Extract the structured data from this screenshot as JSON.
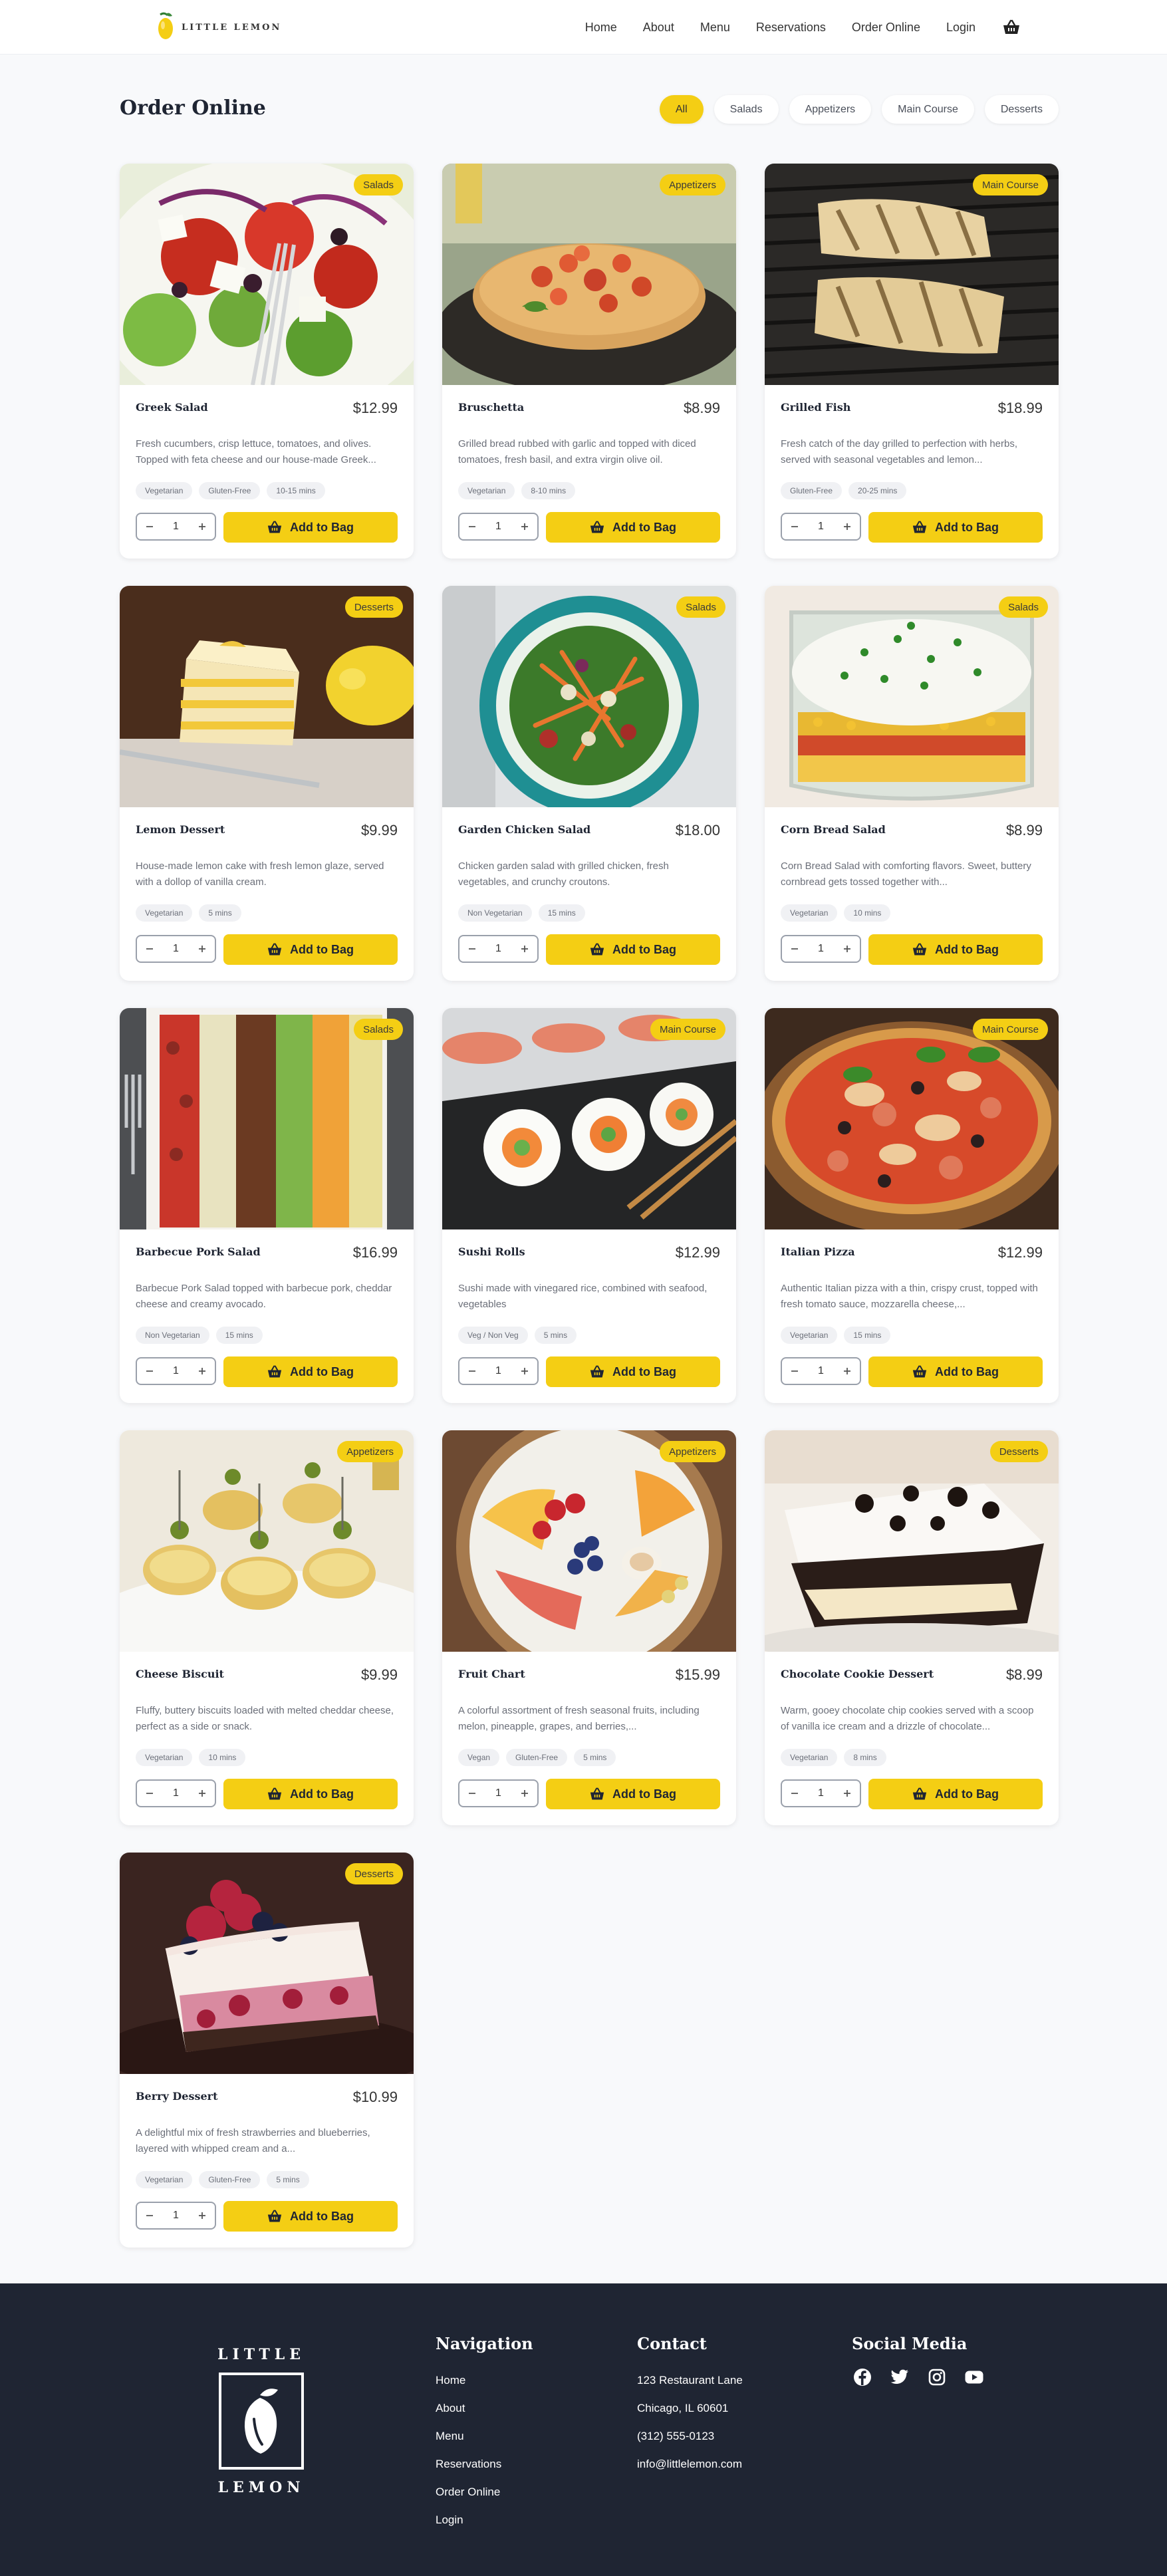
{
  "header": {
    "logo_text": "LITTLE LEMON",
    "nav": [
      "Home",
      "About",
      "Menu",
      "Reservations",
      "Order Online",
      "Login"
    ]
  },
  "page": {
    "title": "Order Online",
    "filters": [
      "All",
      "Salads",
      "Appetizers",
      "Main Course",
      "Desserts"
    ],
    "active_filter": "All"
  },
  "add_label": "Add to Bag",
  "items": [
    {
      "name": "Greek Salad",
      "price": "$12.99",
      "category": "Salads",
      "desc": "Fresh cucumbers, crisp lettuce, tomatoes, and olives. Topped with feta cheese and our house-made Greek...",
      "tags": [
        "Vegetarian",
        "Gluten-Free",
        "10-15 mins"
      ],
      "qty": "1",
      "image": "greek-salad"
    },
    {
      "name": "Bruschetta",
      "price": "$8.99",
      "category": "Appetizers",
      "desc": "Grilled bread rubbed with garlic and topped with diced tomatoes, fresh basil, and extra virgin olive oil.",
      "tags": [
        "Vegetarian",
        "8-10 mins"
      ],
      "qty": "1",
      "image": "bruschetta"
    },
    {
      "name": "Grilled Fish",
      "price": "$18.99",
      "category": "Main Course",
      "desc": "Fresh catch of the day grilled to perfection with herbs, served with seasonal vegetables and lemon...",
      "tags": [
        "Gluten-Free",
        "20-25 mins"
      ],
      "qty": "1",
      "image": "grilled-fish"
    },
    {
      "name": "Lemon Dessert",
      "price": "$9.99",
      "category": "Desserts",
      "desc": "House-made lemon cake with fresh lemon glaze, served with a dollop of vanilla cream.",
      "tags": [
        "Vegetarian",
        "5 mins"
      ],
      "qty": "1",
      "image": "lemon-dessert"
    },
    {
      "name": "Garden Chicken Salad",
      "price": "$18.00",
      "category": "Salads",
      "desc": "Chicken garden salad with grilled chicken, fresh vegetables, and crunchy croutons.",
      "tags": [
        "Non Vegetarian",
        "15 mins"
      ],
      "qty": "1",
      "image": "chicken-salad"
    },
    {
      "name": "Corn Bread Salad",
      "price": "$8.99",
      "category": "Salads",
      "desc": "Corn Bread Salad with comforting flavors. Sweet, buttery cornbread gets tossed together with...",
      "tags": [
        "Vegetarian",
        "10 mins"
      ],
      "qty": "1",
      "image": "cornbread-salad"
    },
    {
      "name": "Barbecue Pork Salad",
      "price": "$16.99",
      "category": "Salads",
      "desc": "Barbecue Pork Salad topped with barbecue pork, cheddar cheese and creamy avocado.",
      "tags": [
        "Non Vegetarian",
        "15 mins"
      ],
      "qty": "1",
      "image": "bbq-salad"
    },
    {
      "name": "Sushi Rolls",
      "price": "$12.99",
      "category": "Main Course",
      "desc": "Sushi made with vinegared rice, combined with seafood, vegetables",
      "tags": [
        "Veg / Non Veg",
        "5 mins"
      ],
      "qty": "1",
      "image": "sushi"
    },
    {
      "name": "Italian Pizza",
      "price": "$12.99",
      "category": "Main Course",
      "desc": "Authentic Italian pizza with a thin, crispy crust, topped with fresh tomato sauce, mozzarella cheese,...",
      "tags": [
        "Vegetarian",
        "15 mins"
      ],
      "qty": "1",
      "image": "pizza"
    },
    {
      "name": "Cheese Biscuit",
      "price": "$9.99",
      "category": "Appetizers",
      "desc": "Fluffy, buttery biscuits loaded with melted cheddar cheese, perfect as a side or snack.",
      "tags": [
        "Vegetarian",
        "10 mins"
      ],
      "qty": "1",
      "image": "biscuit"
    },
    {
      "name": "Fruit Chart",
      "price": "$15.99",
      "category": "Appetizers",
      "desc": "A colorful assortment of fresh seasonal fruits, including melon, pineapple, grapes, and berries,...",
      "tags": [
        "Vegan",
        "Gluten-Free",
        "5 mins"
      ],
      "qty": "1",
      "image": "fruit"
    },
    {
      "name": "Chocolate Cookie Dessert",
      "price": "$8.99",
      "category": "Desserts",
      "desc": "Warm, gooey chocolate chip cookies served with a scoop of vanilla ice cream and a drizzle of chocolate...",
      "tags": [
        "Vegetarian",
        "8 mins"
      ],
      "qty": "1",
      "image": "cookie-dessert"
    },
    {
      "name": "Berry Dessert",
      "price": "$10.99",
      "category": "Desserts",
      "desc": "A delightful mix of fresh strawberries and blueberries, layered with whipped cream and a...",
      "tags": [
        "Vegetarian",
        "Gluten-Free",
        "5 mins"
      ],
      "qty": "1",
      "image": "berry-dessert"
    }
  ],
  "footer": {
    "logo_top": "LITTLE",
    "logo_bottom": "LEMON",
    "nav_heading": "Navigation",
    "nav_links": [
      "Home",
      "About",
      "Menu",
      "Reservations",
      "Order Online",
      "Login"
    ],
    "contact_heading": "Contact",
    "contact_lines": [
      "123 Restaurant Lane",
      "Chicago, IL 60601",
      "(312) 555-0123",
      "info@littlelemon.com"
    ],
    "social_heading": "Social Media",
    "socials": [
      "facebook-icon",
      "twitter-icon",
      "instagram-icon",
      "youtube-icon"
    ]
  },
  "colors": {
    "accent": "#f4ce14",
    "footer_bg": "#1f2533",
    "page_bg": "#f8f9fb"
  }
}
